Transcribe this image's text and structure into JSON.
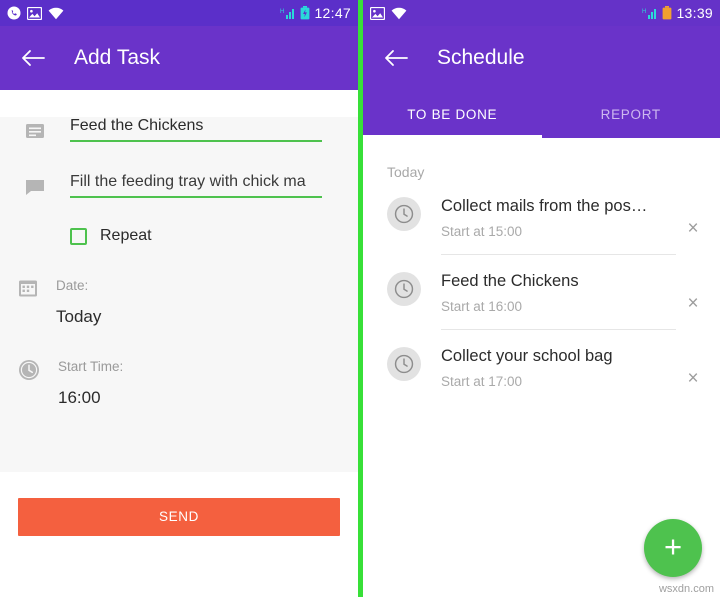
{
  "left_screen": {
    "status_bar": {
      "time": "12:47",
      "icons": [
        "whatsapp-icon",
        "gallery-icon",
        "wifi-icon",
        "signal-icon",
        "battery-icon"
      ]
    },
    "appbar": {
      "back_icon": "back-arrow-icon",
      "title": "Add Task"
    },
    "form": {
      "title_field": {
        "icon": "note-icon",
        "value": "Feed the Chickens"
      },
      "description_field": {
        "icon": "message-icon",
        "value": "Fill the feeding tray with chick ma"
      },
      "repeat": {
        "label": "Repeat",
        "checked": false
      },
      "date": {
        "icon": "calendar-icon",
        "label": "Date:",
        "value": "Today"
      },
      "start_time": {
        "icon": "clock-icon",
        "label": "Start Time:",
        "value": "16:00"
      },
      "send_button": "SEND"
    }
  },
  "right_screen": {
    "status_bar": {
      "time": "13:39",
      "icons": [
        "gallery-icon",
        "wifi-icon",
        "signal-icon",
        "battery-icon"
      ]
    },
    "appbar": {
      "back_icon": "back-arrow-icon",
      "title": "Schedule"
    },
    "tabs": [
      {
        "label": "TO BE DONE",
        "active": true
      },
      {
        "label": "REPORT",
        "active": false
      }
    ],
    "section_label": "Today",
    "tasks": [
      {
        "icon": "clock-icon",
        "title": "Collect mails from the pos…",
        "subtitle": "Start at 15:00",
        "close": "×"
      },
      {
        "icon": "clock-icon",
        "title": "Feed the Chickens",
        "subtitle": "Start at 16:00",
        "close": "×"
      },
      {
        "icon": "clock-icon",
        "title": "Collect your school bag",
        "subtitle": "Start at 17:00",
        "close": "×"
      }
    ],
    "fab": {
      "label": "+",
      "color": "#4ec24e"
    },
    "watermark": "wsxdn.com"
  },
  "colors": {
    "appbar_purple": "#6a33c9",
    "status_purple": "#5b2fc9",
    "accent_green": "#4ec24e",
    "send_orange": "#f4603f",
    "divider_green": "#38e038"
  }
}
